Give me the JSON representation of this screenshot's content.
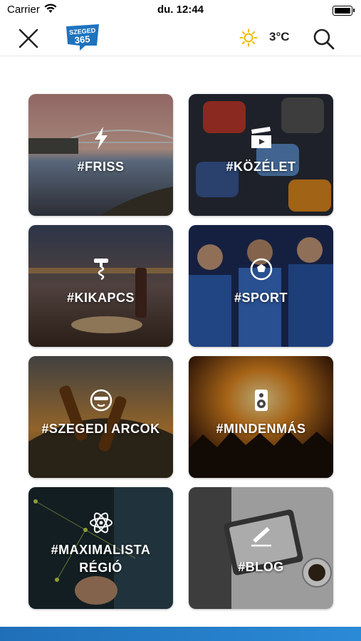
{
  "status_bar": {
    "carrier": "Carrier",
    "time": "du. 12:44"
  },
  "header": {
    "logo_text_top": "SZEGED",
    "logo_text_bottom": "365",
    "temperature": "3°C",
    "icons": [
      "close-icon",
      "sun-icon",
      "search-icon"
    ],
    "colors": {
      "logo_blue": "#1e73be",
      "sun": "#f5b800"
    }
  },
  "categories": [
    {
      "label": "#FRISS",
      "icon": "lightning-icon"
    },
    {
      "label": "#KÖZÉLET",
      "icon": "clapperboard-icon"
    },
    {
      "label": "#KIKAPCS",
      "icon": "corkscrew-icon"
    },
    {
      "label": "#SPORT",
      "icon": "soccer-ball-icon"
    },
    {
      "label": "#SZEGEDI ARCOK",
      "icon": "sunglasses-face-icon"
    },
    {
      "label": "#MINDENMÁS",
      "icon": "speaker-icon"
    },
    {
      "label": "#MAXIMALISTA RÉGIÓ",
      "label_line1": "#MAXIMALISTA",
      "label_line2": "RÉGIÓ",
      "icon": "atom-icon"
    },
    {
      "label": "#BLOG",
      "icon": "pen-writing-icon"
    }
  ],
  "bottom_strip_color": "#2b8ad6"
}
